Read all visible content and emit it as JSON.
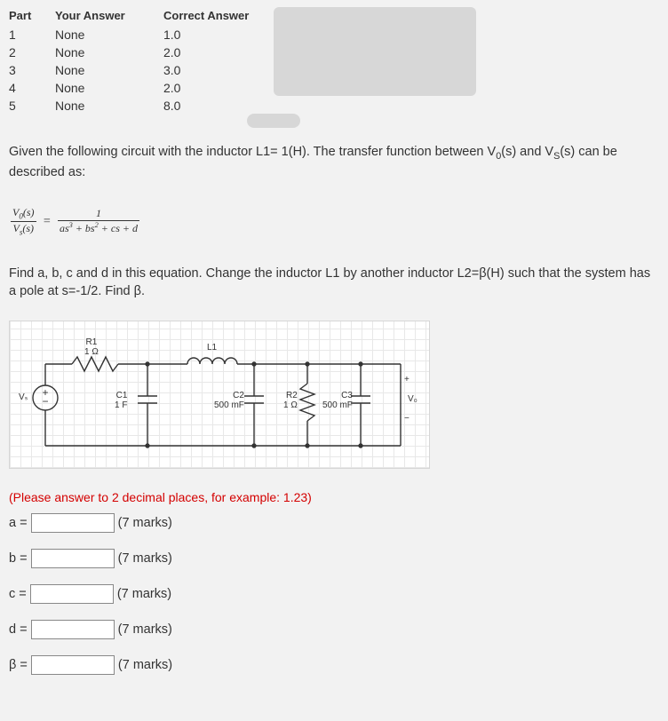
{
  "table": {
    "headers": {
      "part": "Part",
      "your": "Your Answer",
      "correct": "Correct Answer"
    },
    "rows": [
      {
        "part": "1",
        "your": "None",
        "correct": "1.0"
      },
      {
        "part": "2",
        "your": "None",
        "correct": "2.0"
      },
      {
        "part": "3",
        "your": "None",
        "correct": "3.0"
      },
      {
        "part": "4",
        "your": "None",
        "correct": "2.0"
      },
      {
        "part": "5",
        "your": "None",
        "correct": "8.0"
      }
    ]
  },
  "prompt1_pre": "Given the following circuit with the inductor L1= 1(H). The transfer function between V",
  "prompt1_sub1": "0",
  "prompt1_mid": "(s) and V",
  "prompt1_sub2": "S",
  "prompt1_post": "(s) can be described as:",
  "eqn": {
    "left_num_v": "V",
    "left_num_sub": "0",
    "left_num_arg": "(s)",
    "left_den_v": "V",
    "left_den_sub": "s",
    "left_den_arg": "(s)",
    "eq": "=",
    "right_num": "1",
    "right_den_a": "as",
    "right_den_a_sup": "3",
    "right_den_b": "+ bs",
    "right_den_b_sup": "2",
    "right_den_rest": "+ cs + d"
  },
  "prompt2": "Find a, b, c and d in this equation. Change the inductor L1 by another inductor L2=β(H) such that the system has a pole at s=-1/2. Find β.",
  "circuit": {
    "R1": {
      "name": "R1",
      "val": "1 Ω"
    },
    "L1": "L1",
    "C1": {
      "name": "C1",
      "val": "1 F"
    },
    "C2": {
      "name": "C2",
      "val": "500 mF"
    },
    "R2": {
      "name": "R2",
      "val": "1 Ω"
    },
    "C3": {
      "name": "C3",
      "val": "500 mF"
    },
    "Vs": "Vₛ",
    "Vo": "V₀",
    "plus": "+",
    "minus": "−"
  },
  "note": "(Please answer to 2 decimal places, for example: 1.23)",
  "marks": "(7 marks)",
  "fields": {
    "a": "a =",
    "b": "b =",
    "c": "c =",
    "d": "d =",
    "beta": "β ="
  }
}
